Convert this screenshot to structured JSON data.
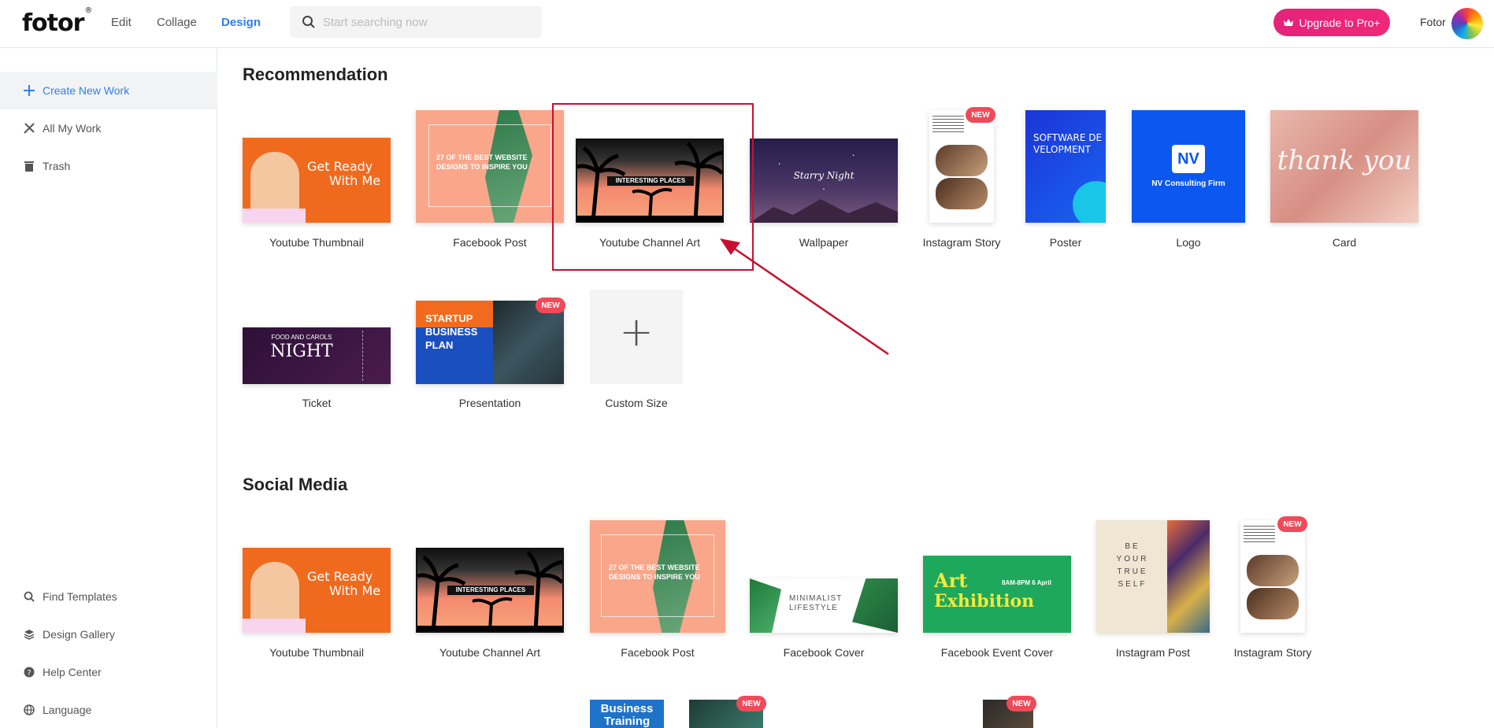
{
  "app": {
    "logo": "fotor",
    "logo_mark": "®"
  },
  "nav": {
    "edit": "Edit",
    "collage": "Collage",
    "design": "Design"
  },
  "search": {
    "placeholder": "Start searching now"
  },
  "header": {
    "upgrade_label": "Upgrade to Pro+",
    "username": "Fotor"
  },
  "sidebar": {
    "items": [
      {
        "label": "Create New Work",
        "icon": "plus-icon"
      },
      {
        "label": "All My Work",
        "icon": "tools-icon"
      },
      {
        "label": "Trash",
        "icon": "trash-icon"
      }
    ],
    "bottom": [
      {
        "label": "Find Templates",
        "icon": "search-icon"
      },
      {
        "label": "Design Gallery",
        "icon": "layers-icon"
      },
      {
        "label": "Help Center",
        "icon": "help-icon"
      },
      {
        "label": "Language",
        "icon": "globe-icon"
      }
    ]
  },
  "recommendation": {
    "title": "Recommendation",
    "items": [
      {
        "label": "Youtube Thumbnail",
        "t1": "Get Ready",
        "t2": "With Me"
      },
      {
        "label": "Facebook Post",
        "t1": "27 OF THE BEST WEBSITE",
        "t2": "DESIGNS TO INSPIRE YOU"
      },
      {
        "label": "Youtube Channel Art",
        "t1": "INTERESTING PLACES"
      },
      {
        "label": "Wallpaper",
        "t1": "Starry Night"
      },
      {
        "label": "Instagram Story",
        "badge": "NEW"
      },
      {
        "label": "Poster",
        "t1": "SOFTWARE DE",
        "t2": "VELOPMENT"
      },
      {
        "label": "Logo",
        "t1": "NV",
        "t2": "NV Consulting Firm"
      },
      {
        "label": "Card",
        "t1": "thank you"
      },
      {
        "label": "Ticket",
        "t1": "FOOD AND CAROLS",
        "t2": "NIGHT"
      },
      {
        "label": "Presentation",
        "t1": "STARTUP",
        "t2": "BUSINESS",
        "t3": "PLAN",
        "badge": "NEW"
      },
      {
        "label": "Custom Size",
        "t1": "+"
      }
    ]
  },
  "social": {
    "title": "Social Media",
    "items": [
      {
        "label": "Youtube Thumbnail",
        "t1": "Get Ready",
        "t2": "With Me"
      },
      {
        "label": "Youtube Channel Art",
        "t1": "INTERESTING PLACES"
      },
      {
        "label": "Facebook Post",
        "t1": "27 OF THE BEST WEBSITE",
        "t2": "DESIGNS TO INSPIRE YOU"
      },
      {
        "label": "Facebook Cover",
        "t1": "MINIMALIST",
        "t2": "LIFESTYLE"
      },
      {
        "label": "Facebook Event Cover",
        "t1": "Art",
        "t2": "Exhibition",
        "t3": "8AM-8PM 6 April"
      },
      {
        "label": "Instagram Post",
        "t1": "BE",
        "t2": "YOUR",
        "t3": "TRUE",
        "t4": "SELF"
      },
      {
        "label": "Instagram Story",
        "badge": "NEW"
      }
    ],
    "row3": [
      {
        "t1": "Business",
        "t2": "Training"
      },
      {
        "badge": "NEW"
      },
      {
        "badge": "NEW"
      }
    ]
  }
}
